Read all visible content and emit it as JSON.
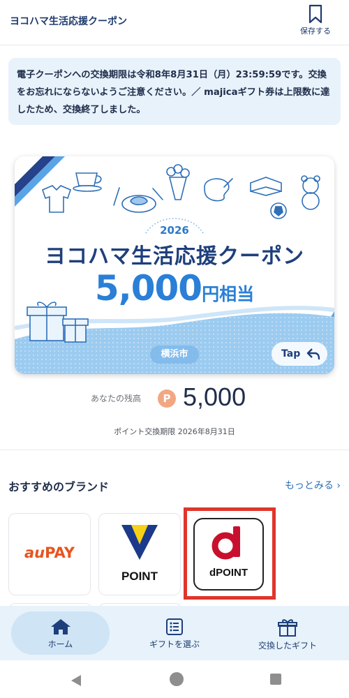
{
  "header": {
    "title": "ヨコハマ生活応援クーポン",
    "save_label": "保存する"
  },
  "notice": {
    "text": "電子クーポンへの交換期限は令和8年8月31日（月）23:59:59です。交換をお忘れにならないようご注意ください。／ majicaギフト券は上限数に達したため、交換終了しました。"
  },
  "coupon": {
    "year": "2026",
    "name": "ヨコハマ生活応援クーポン",
    "amount": "5,000",
    "amount_unit": "円相当",
    "city": "横浜市",
    "tap_label": "Tap"
  },
  "balance": {
    "label": "あなたの残高",
    "point_symbol": "P",
    "value": "5,000",
    "expiry": "ポイント交換期限 2026年8月31日"
  },
  "brands": {
    "title": "おすすめのブランド",
    "more_label": "もっとみる",
    "items": [
      {
        "name_a": "au",
        "name_b": "PAY",
        "color": "#e8541e"
      },
      {
        "label": "POINT",
        "colors": [
          "#f7d117",
          "#1b3a8c"
        ]
      },
      {
        "label_d": "d",
        "label": "POINT",
        "color": "#c8102e"
      }
    ]
  },
  "bottom_nav": {
    "items": [
      {
        "label": "ホーム",
        "icon": "home-icon"
      },
      {
        "label": "ギフトを選ぶ",
        "icon": "list-icon"
      },
      {
        "label": "交換したギフト",
        "icon": "gift-icon"
      }
    ]
  },
  "colors": {
    "accent": "#2a7fd6",
    "navy": "#1e3f7c",
    "highlight": "#e0352b",
    "nav_bg": "#e7f2fb"
  }
}
